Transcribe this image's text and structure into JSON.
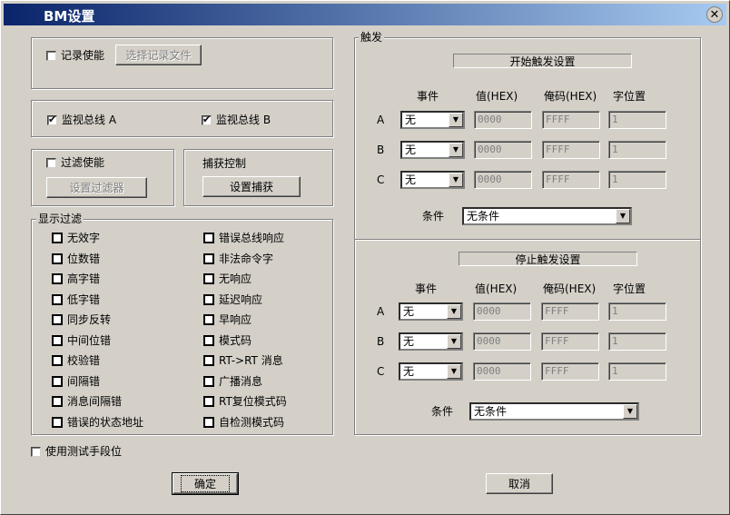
{
  "window": {
    "title": "BM设置",
    "close_glyph": "✕"
  },
  "record": {
    "enable_label": "记录使能",
    "enable_checked": false,
    "choose_file_button": "选择记录文件"
  },
  "monitor": {
    "bus_a_label": "监视总线 A",
    "bus_a_checked": true,
    "bus_b_label": "监视总线 B",
    "bus_b_checked": true
  },
  "filter": {
    "enable_label": "过滤使能",
    "enable_checked": false,
    "set_filter_button": "设置过滤器"
  },
  "capture": {
    "title": "捕获控制",
    "set_capture_button": "设置捕获"
  },
  "display_filter": {
    "title": "显示过滤",
    "left_items": [
      "无效字",
      "位数错",
      "高字错",
      "低字错",
      "同步反转",
      "中间位错",
      "校验错",
      "间隔错",
      "消息间隔错",
      "错误的状态地址"
    ],
    "right_items": [
      "错误总线响应",
      "非法命令字",
      "无响应",
      "延迟响应",
      "早响应",
      "模式码",
      "RT->RT 消息",
      "广播消息",
      "RT复位模式码",
      "自检测模式码"
    ]
  },
  "test_bit": {
    "label": "使用测试手段位",
    "checked": false
  },
  "trigger": {
    "title": "触发",
    "start": {
      "title": "开始触发设置",
      "headers": {
        "event": "事件",
        "value": "值(HEX)",
        "mask": "俺码(HEX)",
        "word_pos": "字位置"
      },
      "rows": [
        {
          "label": "A",
          "event": "无",
          "value": "0000",
          "mask": "FFFF",
          "word_pos": "1"
        },
        {
          "label": "B",
          "event": "无",
          "value": "0000",
          "mask": "FFFF",
          "word_pos": "1"
        },
        {
          "label": "C",
          "event": "无",
          "value": "0000",
          "mask": "FFFF",
          "word_pos": "1"
        }
      ],
      "condition_label": "条件",
      "condition_value": "无条件"
    },
    "stop": {
      "title": "停止触发设置",
      "headers": {
        "event": "事件",
        "value": "值(HEX)",
        "mask": "俺码(HEX)",
        "word_pos": "字位置"
      },
      "rows": [
        {
          "label": "A",
          "event": "无",
          "value": "0000",
          "mask": "FFFF",
          "word_pos": "1"
        },
        {
          "label": "B",
          "event": "无",
          "value": "0000",
          "mask": "FFFF",
          "word_pos": "1"
        },
        {
          "label": "C",
          "event": "无",
          "value": "0000",
          "mask": "FFFF",
          "word_pos": "1"
        }
      ],
      "condition_label": "条件",
      "condition_value": "无条件"
    }
  },
  "buttons": {
    "ok": "确定",
    "cancel": "取消"
  },
  "icons": {
    "checkbox_tick": "✔",
    "dropdown_arrow": "▼"
  }
}
